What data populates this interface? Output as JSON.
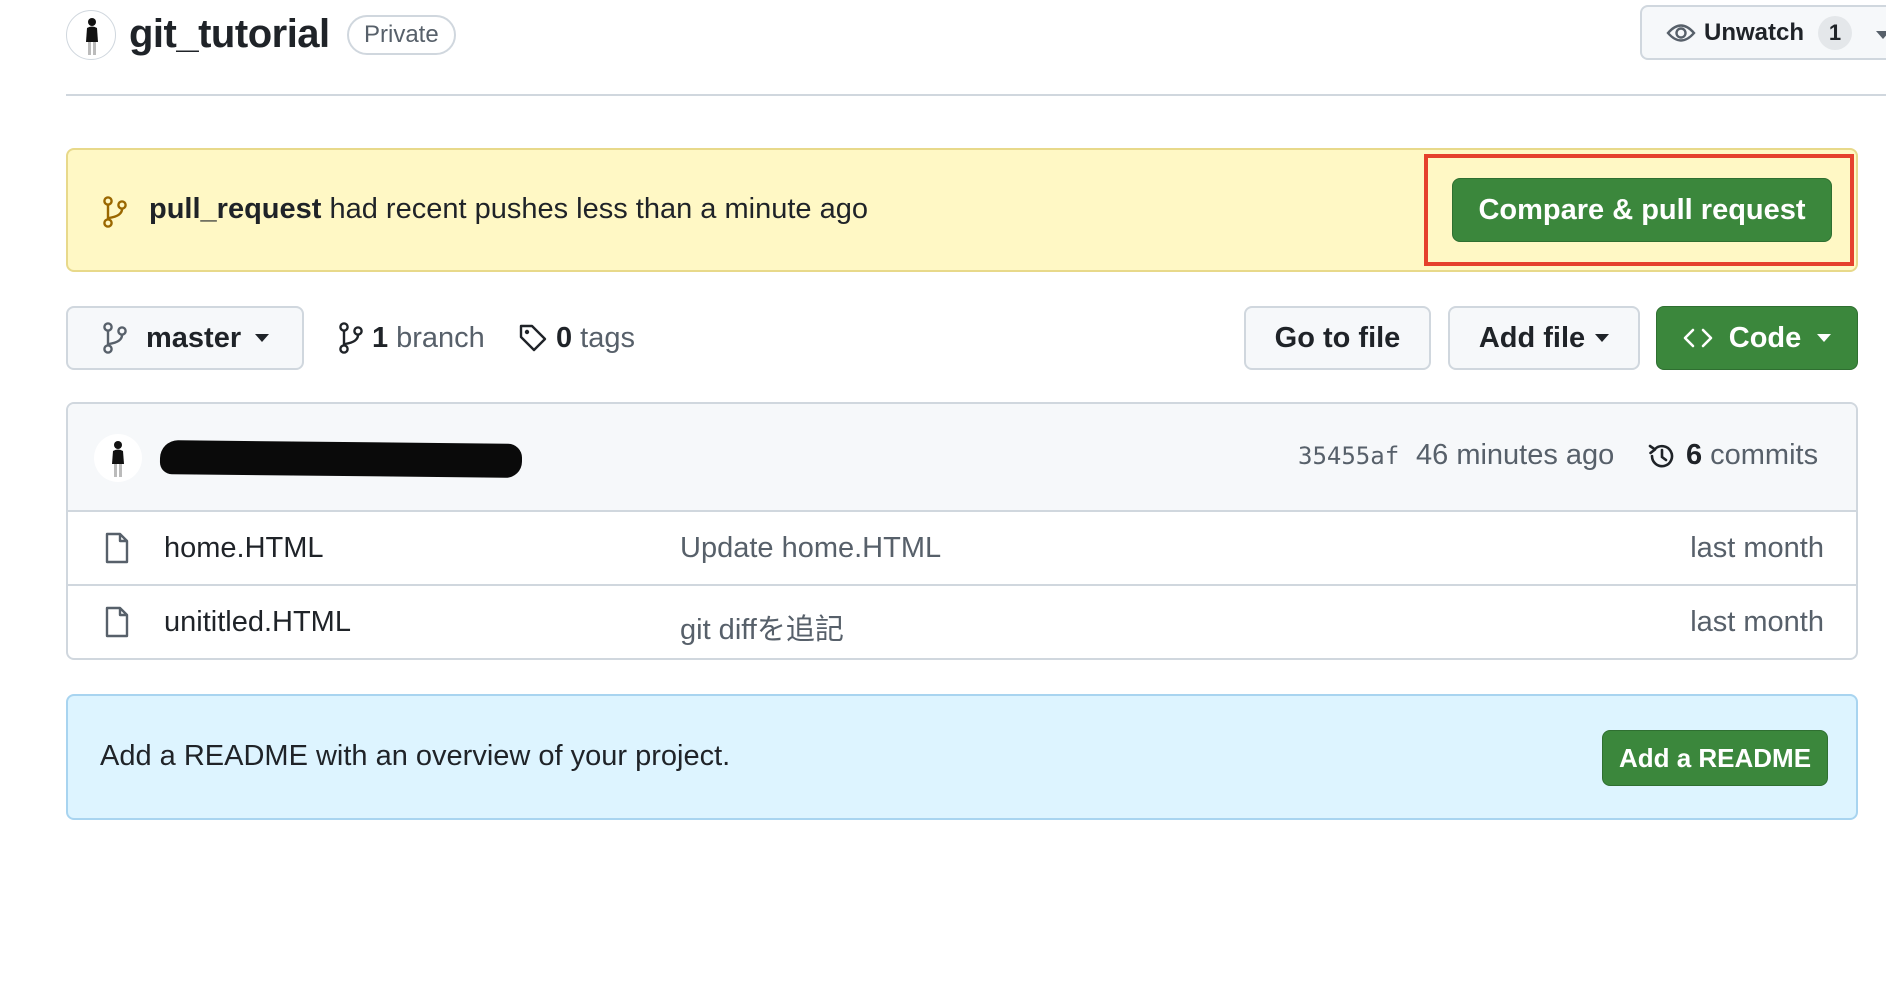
{
  "repo": {
    "name": "git_tutorial",
    "visibility": "Private",
    "unwatch_label": "Unwatch",
    "watch_count": "1"
  },
  "push_banner": {
    "branch": "pull_request",
    "message": " had recent pushes less than a minute ago",
    "button_label": "Compare & pull request"
  },
  "toolbar": {
    "current_branch": "master",
    "branch_count": "1",
    "branch_label": "branch",
    "tag_count": "0",
    "tag_label": "tags",
    "goto_file_label": "Go to file",
    "add_file_label": "Add file",
    "code_label": "Code"
  },
  "latest_commit": {
    "sha": "35455af",
    "time": "46 minutes ago",
    "commit_count": "6",
    "commit_label": "commits"
  },
  "files": [
    {
      "name": "home.HTML",
      "message": "Update home.HTML",
      "age": "last month"
    },
    {
      "name": "unititled.HTML",
      "message": "git diffを追記",
      "age": "last month"
    }
  ],
  "readme": {
    "text": "Add a README with an overview of your project.",
    "button_label": "Add a README"
  },
  "colors": {
    "primary_green": "#3b873c",
    "highlight_red": "#e5412d",
    "push_banner_bg": "#fff8c5",
    "readme_banner_bg": "#ddf4ff"
  }
}
